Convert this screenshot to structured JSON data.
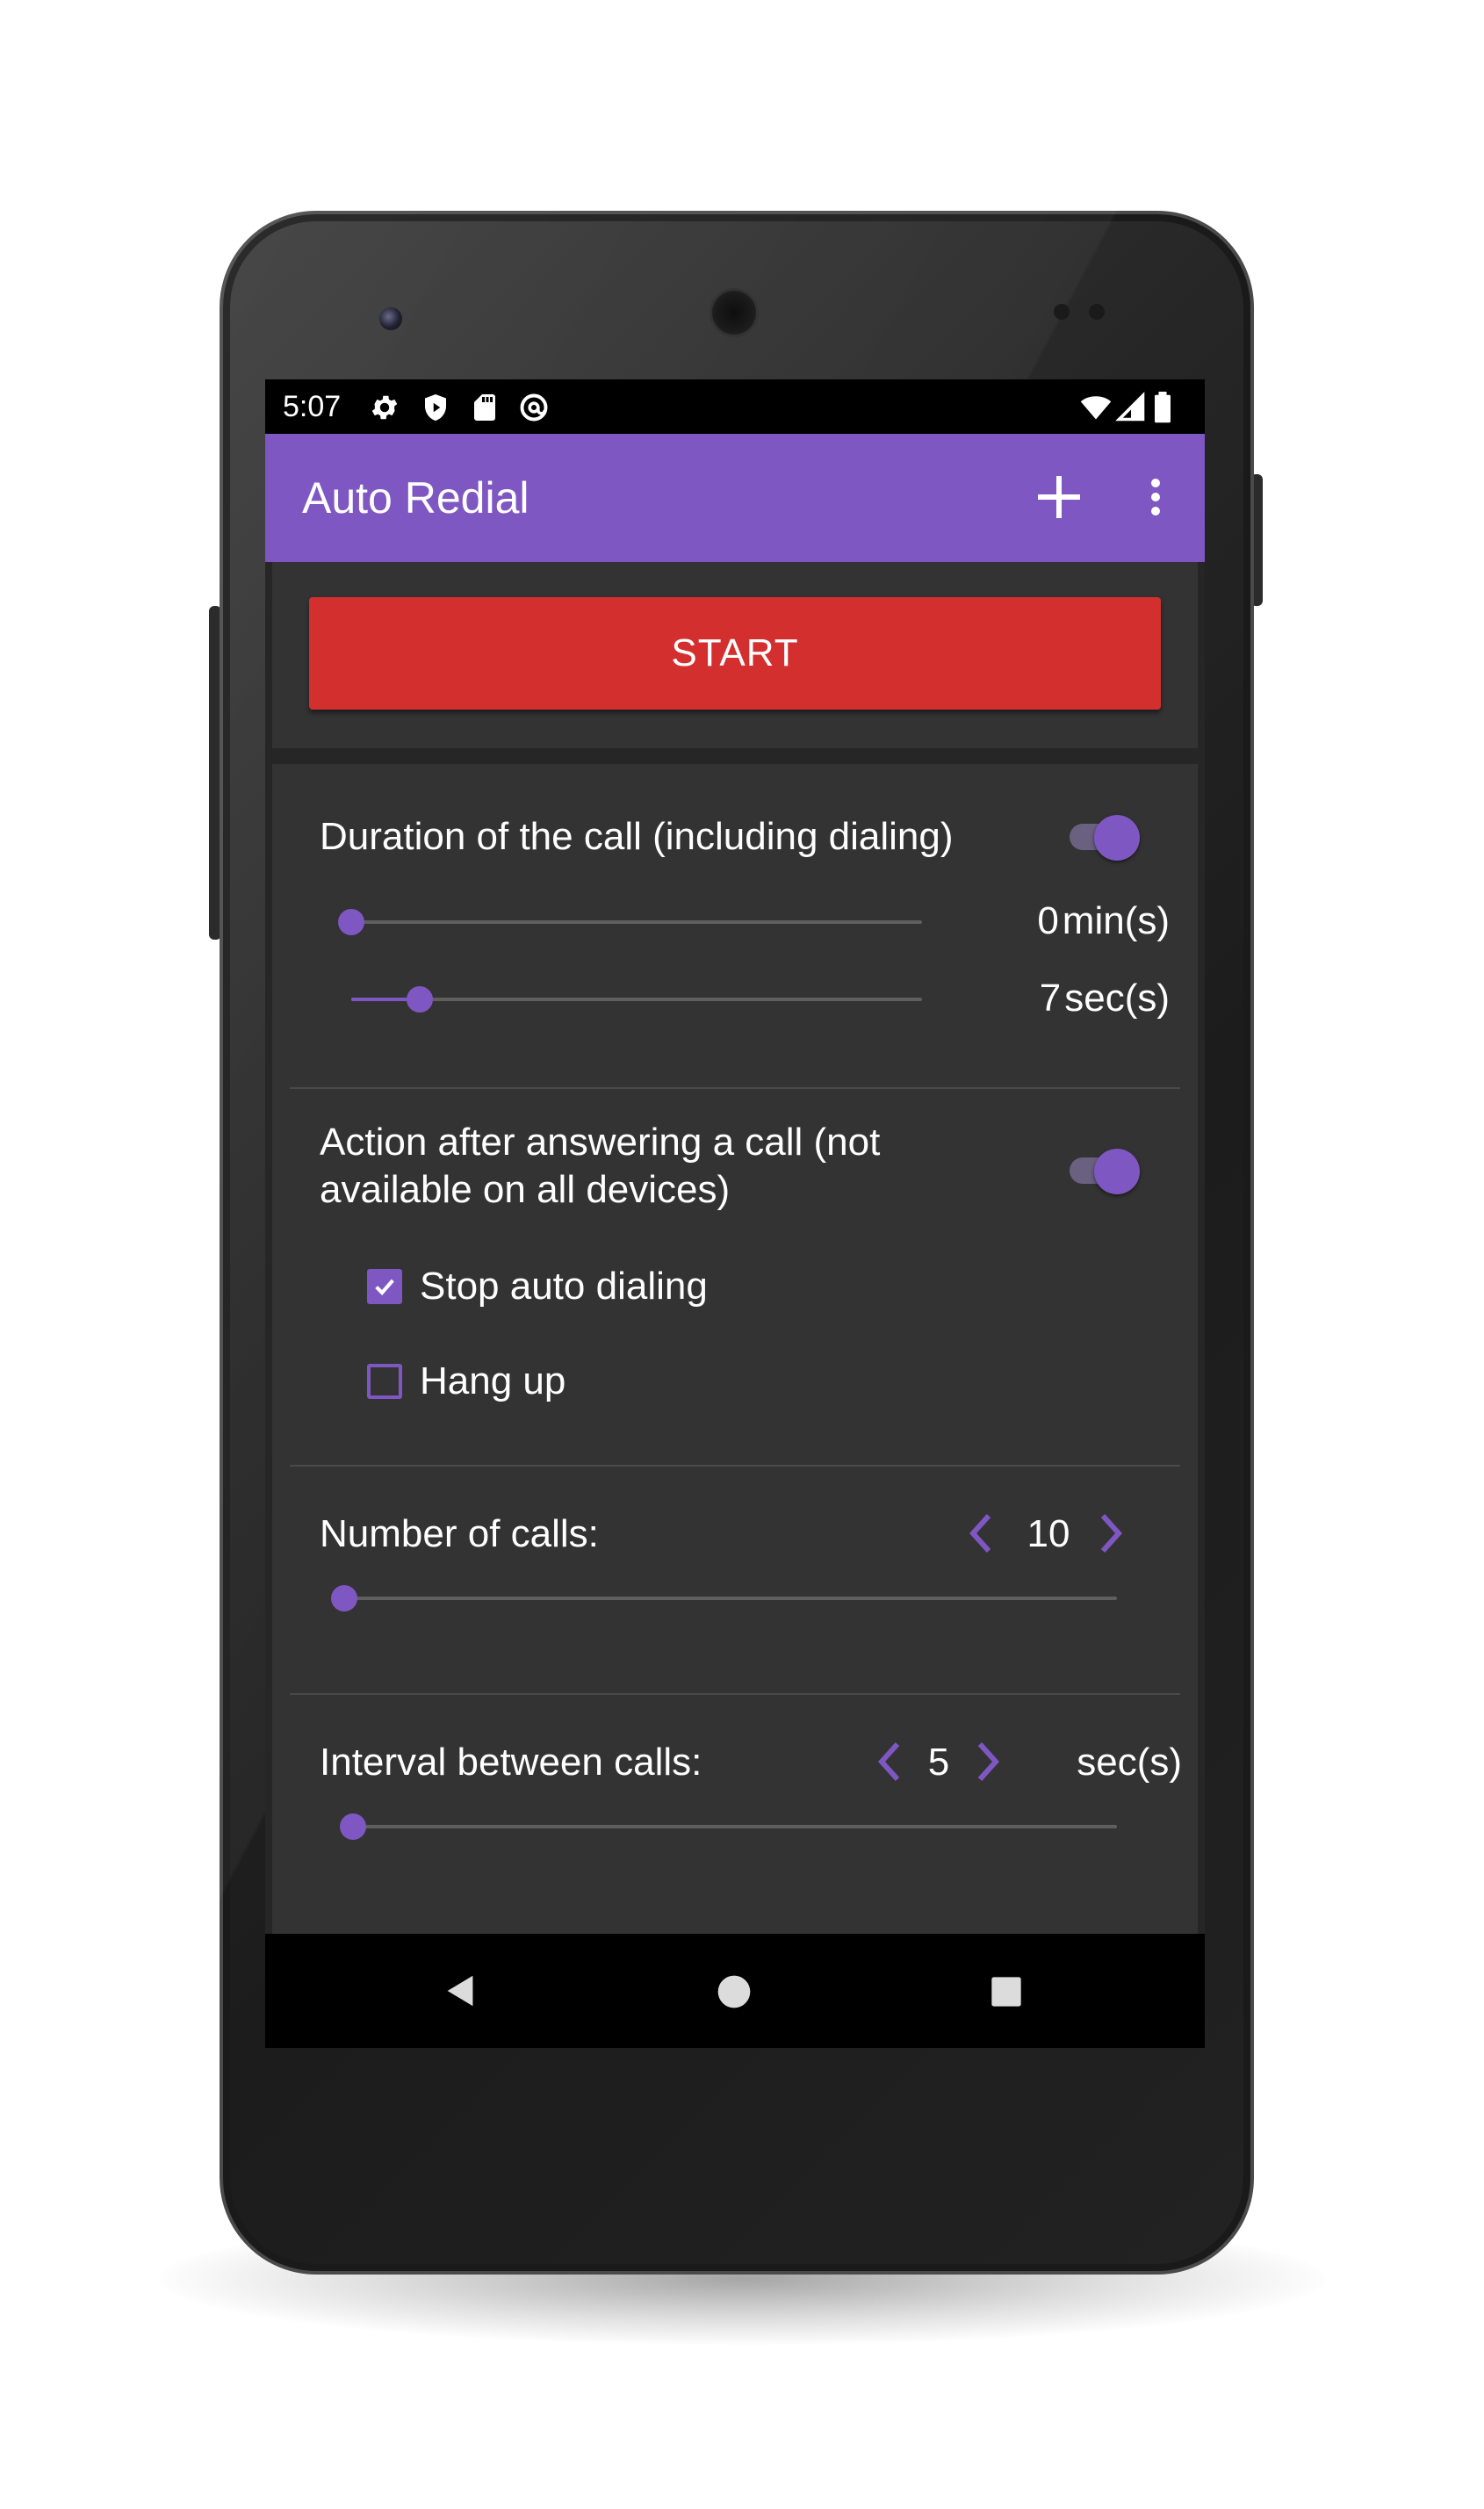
{
  "status_bar": {
    "time": "5:07",
    "left_icons": [
      "gear-icon",
      "shield-icon",
      "sd-card-icon",
      "at-sign-icon"
    ],
    "right_icons": [
      "wifi-icon",
      "cell-signal-icon",
      "battery-icon"
    ]
  },
  "app_bar": {
    "title": "Auto Redial",
    "actions": [
      "add-icon",
      "overflow-menu-icon"
    ]
  },
  "start_button": {
    "label": "START",
    "color": "#d32f2f"
  },
  "duration_section": {
    "label": "Duration of the call (including dialing)",
    "enabled": true,
    "minutes": {
      "value": 0,
      "unit": "min(s)",
      "fraction": 0.0
    },
    "seconds": {
      "value": 7,
      "unit": "sec(s)",
      "fraction": 0.12
    }
  },
  "answer_action_section": {
    "label_line1": "Action after answering a call (not",
    "label_line2": "available on all devices)",
    "enabled": true,
    "options": [
      {
        "label": "Stop auto dialing",
        "checked": true
      },
      {
        "label": "Hang up",
        "checked": false
      }
    ]
  },
  "calls_section": {
    "label": "Number of calls:",
    "value": "10",
    "fraction": 0.0
  },
  "interval_section": {
    "label": "Interval between calls:",
    "value": "5",
    "unit": "sec(s)",
    "fraction": 0.0
  },
  "nav_bar": {
    "buttons": [
      "back-icon",
      "home-icon",
      "recents-icon"
    ]
  },
  "colors": {
    "accent": "#7e57c2",
    "app_bar": "#7e57c2",
    "start": "#d32f2f",
    "card": "#333333",
    "background": "#262626"
  }
}
